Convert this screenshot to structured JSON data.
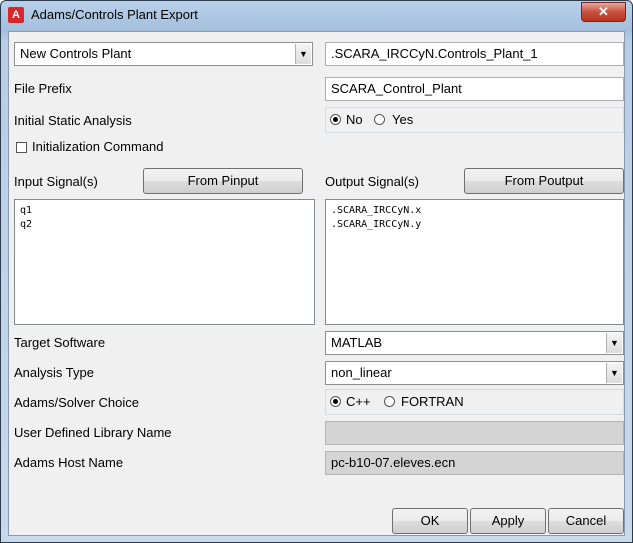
{
  "window": {
    "title": "Adams/Controls Plant Export",
    "app_icon_letter": "A",
    "close_symbol": "✕"
  },
  "plant": {
    "selector_value": "New Controls Plant",
    "name_value": ".SCARA_IRCCyN.Controls_Plant_1"
  },
  "file_prefix": {
    "label": "File Prefix",
    "value": "SCARA_Control_Plant"
  },
  "initial_static": {
    "label": "Initial Static Analysis",
    "options": [
      "No",
      "Yes"
    ],
    "selected": "No"
  },
  "init_command": {
    "label": "Initialization Command",
    "checked": false
  },
  "input_signals": {
    "label": "Input Signal(s)",
    "button": "From Pinput",
    "items": [
      "q1",
      "q2"
    ]
  },
  "output_signals": {
    "label": "Output Signal(s)",
    "button": "From Poutput",
    "items": [
      ".SCARA_IRCCyN.x",
      ".SCARA_IRCCyN.y"
    ]
  },
  "target_software": {
    "label": "Target Software",
    "value": "MATLAB"
  },
  "analysis_type": {
    "label": "Analysis Type",
    "value": "non_linear"
  },
  "solver_choice": {
    "label": "Adams/Solver Choice",
    "options": [
      "C++",
      "FORTRAN"
    ],
    "selected": "C++"
  },
  "user_library": {
    "label": "User Defined Library Name",
    "value": ""
  },
  "host_name": {
    "label": "Adams Host Name",
    "value": "pc-b10-07.eleves.ecn"
  },
  "footer": {
    "ok": "OK",
    "apply": "Apply",
    "cancel": "Cancel"
  },
  "icons": {
    "dropdown_arrow": "▼"
  }
}
